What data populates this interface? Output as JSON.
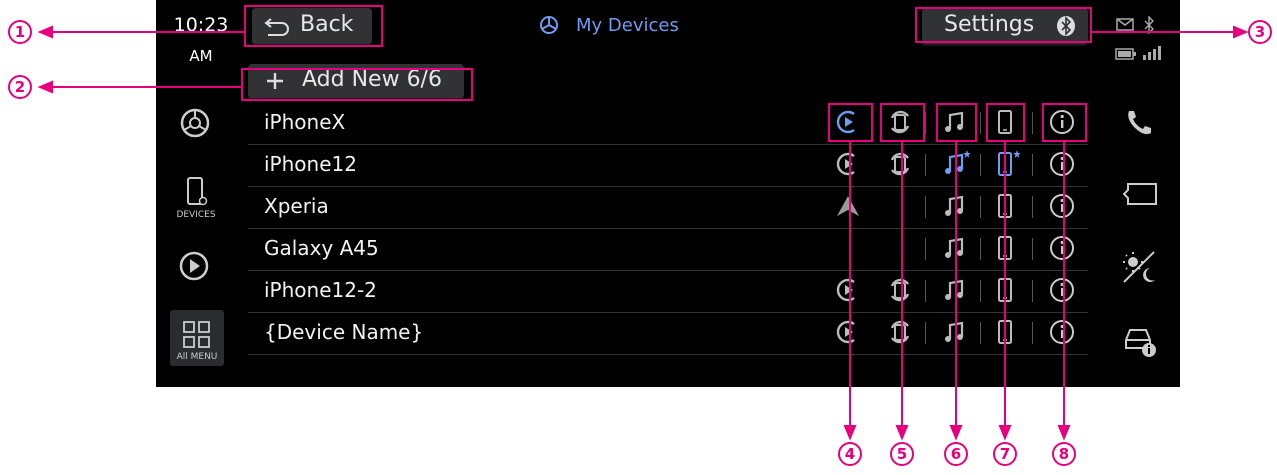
{
  "clock": {
    "time": "10:23",
    "ampm": "AM"
  },
  "header": {
    "title": "My Devices",
    "back_label": "Back",
    "settings_label": "Settings"
  },
  "add_button": {
    "label": "Add New 6/6"
  },
  "sidebar_left": {
    "devices_label": "DEVICES",
    "all_menu_label": "All MENU"
  },
  "devices": [
    {
      "name": "iPhoneX"
    },
    {
      "name": "iPhone12"
    },
    {
      "name": "Xperia"
    },
    {
      "name": "Galaxy A45"
    },
    {
      "name": "iPhone12-2"
    },
    {
      "name": "{Device Name}"
    }
  ],
  "callouts": [
    "1",
    "2",
    "3",
    "4",
    "5",
    "6",
    "7",
    "8"
  ],
  "colors": {
    "accent": "#6f9cf0",
    "callout": "#e6007e",
    "background": "#000000",
    "button": "#303234"
  }
}
